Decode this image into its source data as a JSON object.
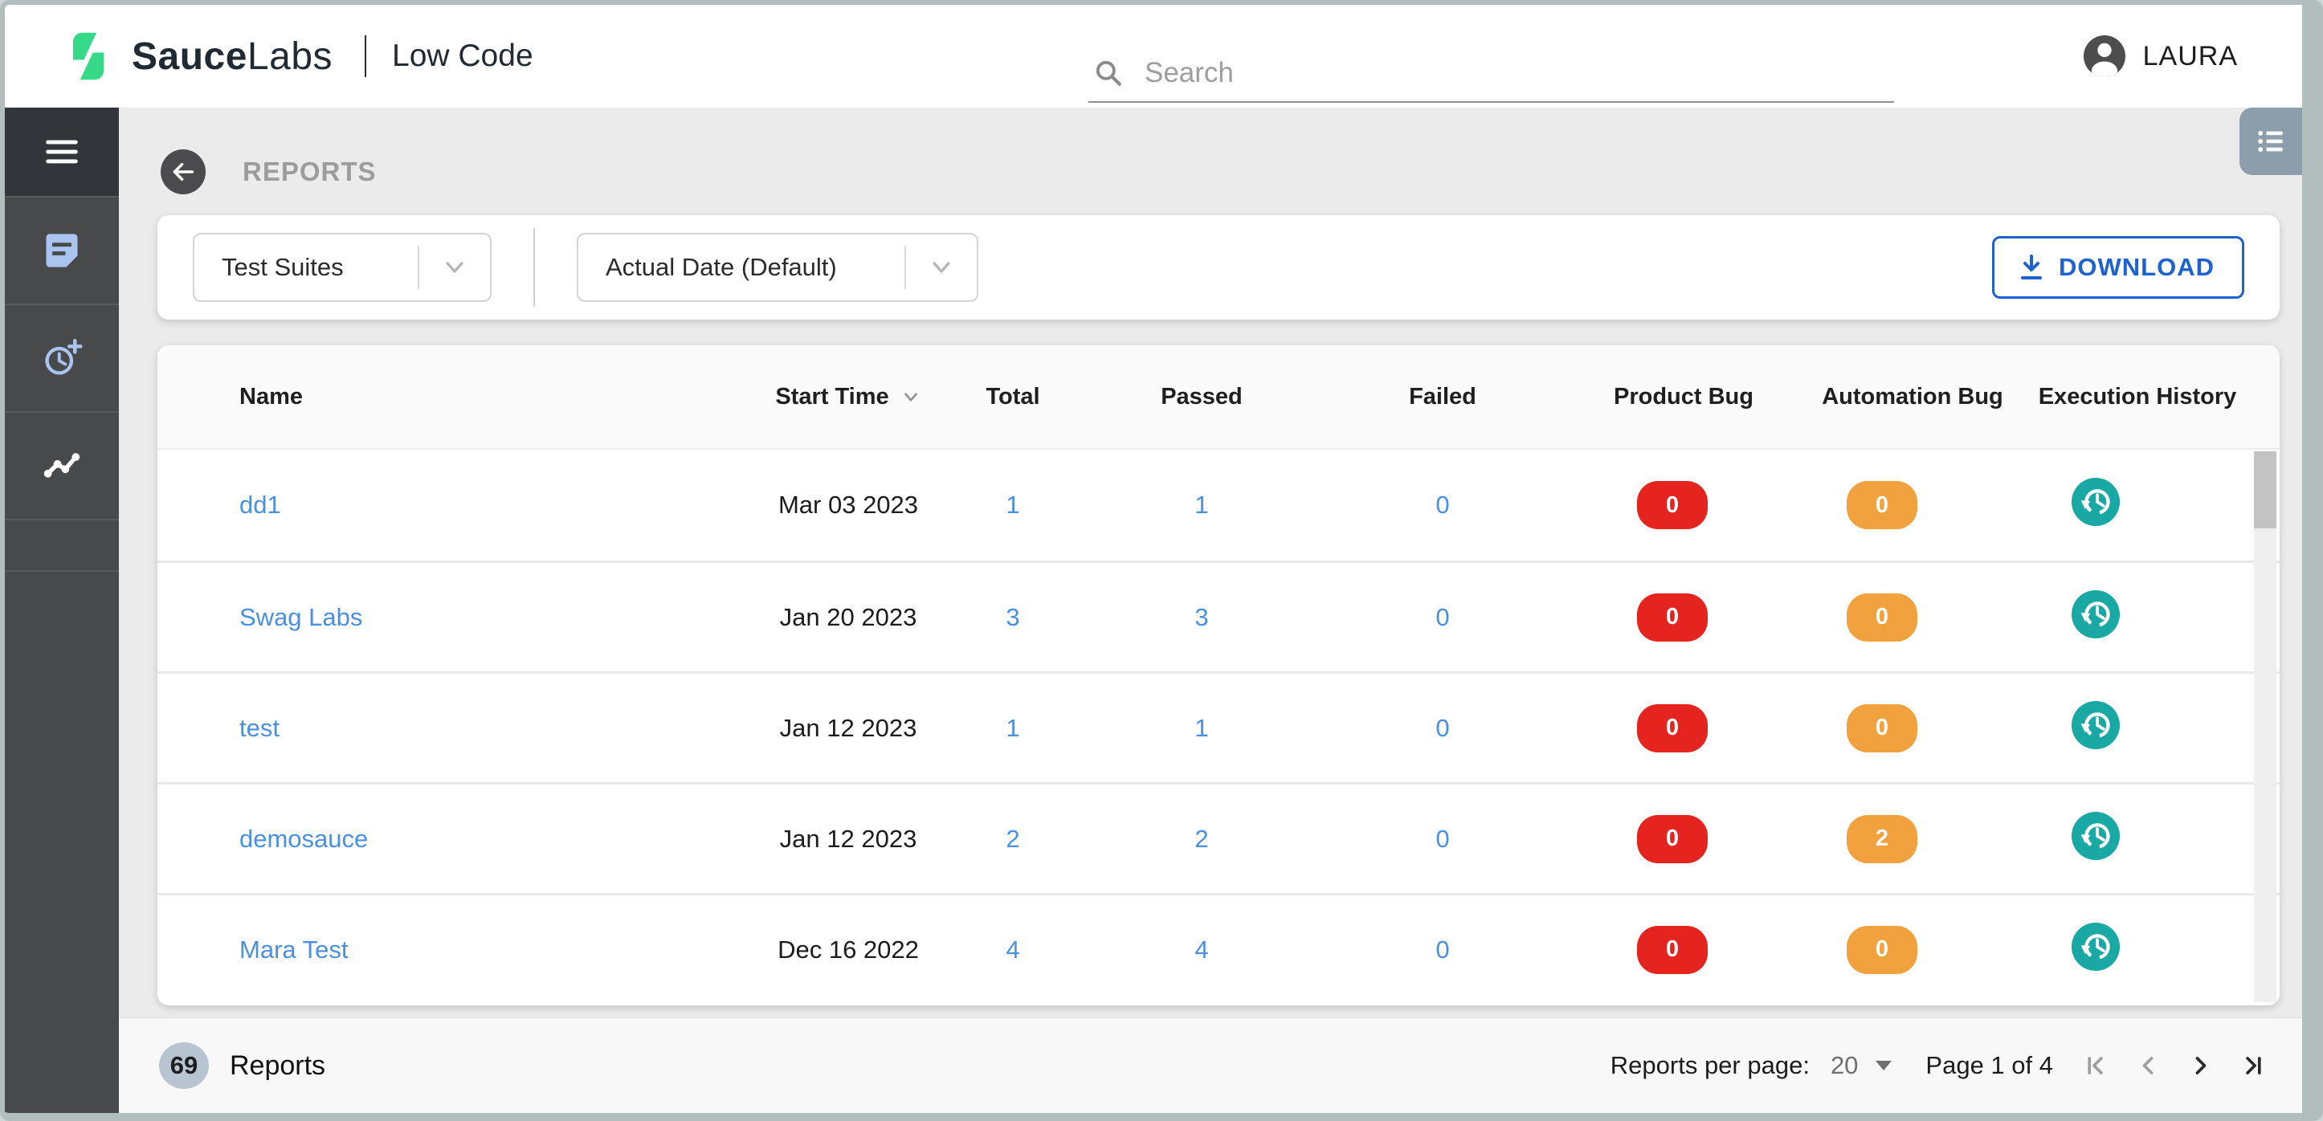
{
  "header": {
    "brand": {
      "name_bold": "Sauce",
      "name_light": "Labs",
      "product": "Low Code"
    },
    "search": {
      "placeholder": "Search"
    },
    "user": {
      "name": "LAURA"
    }
  },
  "sidebar": {
    "items": [
      {
        "icon": "hamburger-menu-icon"
      },
      {
        "icon": "document-icon"
      },
      {
        "icon": "clock-plus-icon"
      },
      {
        "icon": "timeline-chart-icon",
        "active": true
      }
    ]
  },
  "page": {
    "title": "REPORTS"
  },
  "filters": {
    "suite_filter": "Test Suites",
    "date_filter": "Actual Date (Default)",
    "download_label": "DOWNLOAD"
  },
  "table": {
    "columns": [
      "Name",
      "Start Time",
      "Total",
      "Passed",
      "Failed",
      "Product Bug",
      "Automation Bug",
      "Execution History"
    ],
    "rows": [
      {
        "name": "dd1",
        "start_time": "Mar 03 2023",
        "total": "1",
        "passed": "1",
        "failed": "0",
        "product_bug": "0",
        "automation_bug": "0"
      },
      {
        "name": "Swag Labs",
        "start_time": "Jan 20 2023",
        "total": "3",
        "passed": "3",
        "failed": "0",
        "product_bug": "0",
        "automation_bug": "0"
      },
      {
        "name": "test",
        "start_time": "Jan 12 2023",
        "total": "1",
        "passed": "1",
        "failed": "0",
        "product_bug": "0",
        "automation_bug": "0"
      },
      {
        "name": "demosauce",
        "start_time": "Jan 12 2023",
        "total": "2",
        "passed": "2",
        "failed": "0",
        "product_bug": "0",
        "automation_bug": "2"
      },
      {
        "name": "Mara Test",
        "start_time": "Dec 16 2022",
        "total": "4",
        "passed": "4",
        "failed": "0",
        "product_bug": "0",
        "automation_bug": "0"
      }
    ]
  },
  "footer": {
    "count": "69",
    "count_label": "Reports",
    "per_page_label": "Reports per page:",
    "per_page_value": "20",
    "page_info": "Page 1 of 4",
    "pagination": [
      {
        "name": "first-page",
        "enabled": false
      },
      {
        "name": "previous-page",
        "enabled": false
      },
      {
        "name": "next-page",
        "enabled": true
      },
      {
        "name": "last-page",
        "enabled": true
      }
    ]
  },
  "colors": {
    "brand_green": "#35d988",
    "link_blue": "#4a90e2",
    "download_blue": "#1d62cf",
    "product_bug_red": "#e5231f",
    "automation_bug_orange": "#f1a13d",
    "history_teal": "#19a8a3",
    "sidebar_dark": "#47494b",
    "sidebar_icon_blue": "#a9c4ee",
    "page_background": "#ebebeb"
  }
}
